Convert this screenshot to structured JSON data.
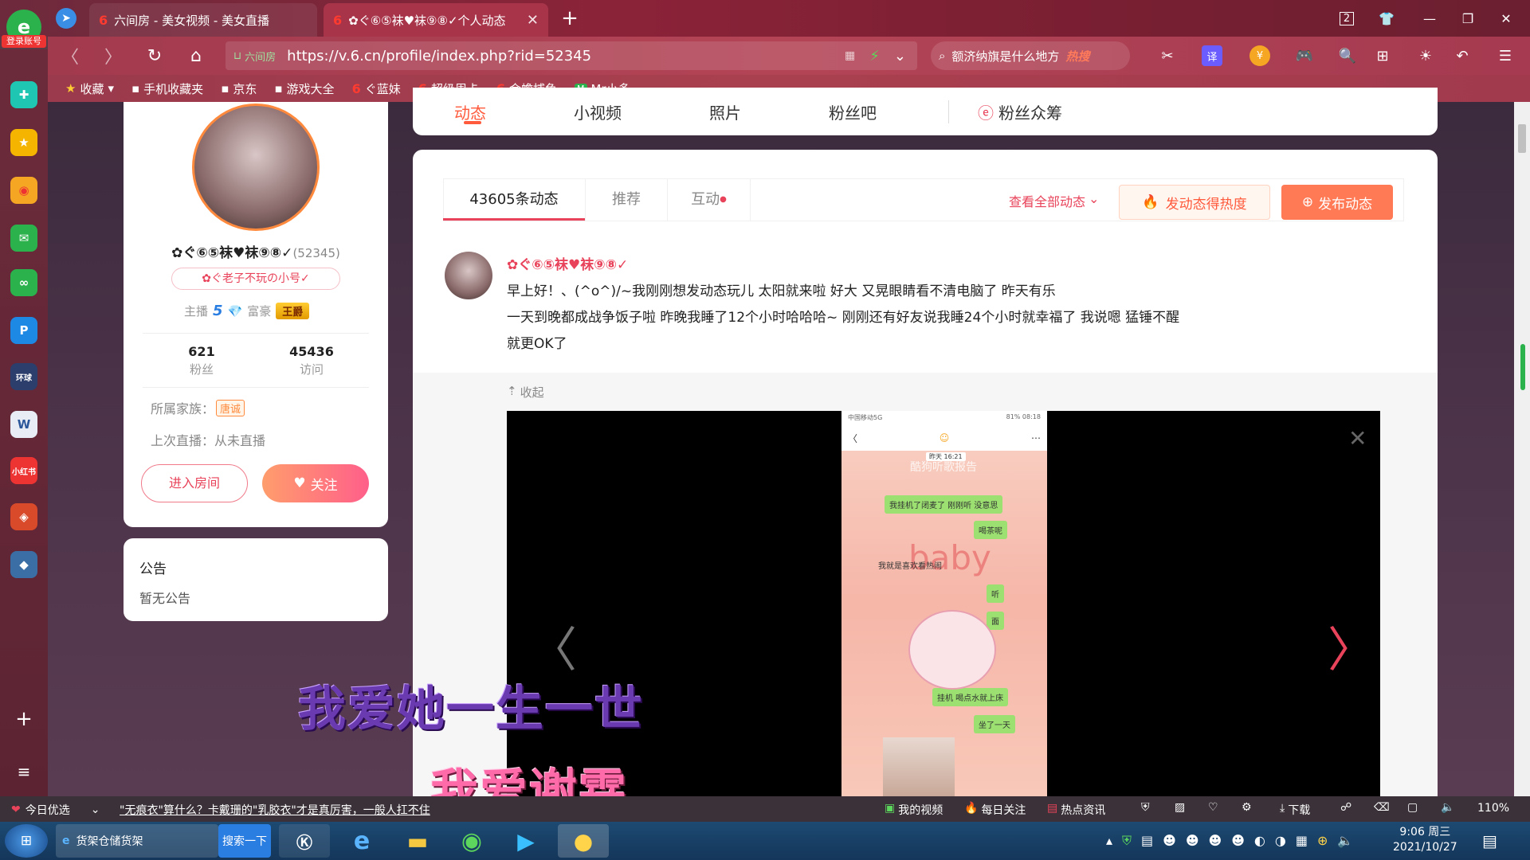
{
  "browser": {
    "login_badge": "登录账号",
    "tabs": [
      {
        "label": "六间房 - 美女视频 - 美女直播",
        "active": false
      },
      {
        "label": "✿ぐ⑥⑤袜♥袜⑨⑧✓个人动态",
        "active": true
      }
    ],
    "tab_count": "2",
    "url_prefix": "六间房",
    "url": "https://v.6.cn/profile/index.php?rid=52345",
    "search_text": "额济纳旗是什么地方",
    "search_hot": "热搜",
    "bookmarks": [
      "收藏",
      "手机收藏夹",
      "京东",
      "游戏大全",
      "ぐ蓝妹",
      "超级周卡",
      "金蟾捕鱼",
      "Mr小多"
    ]
  },
  "profile": {
    "nav_tabs": [
      "动态",
      "小视频",
      "照片",
      "粉丝吧",
      "粉丝众筹"
    ],
    "name": "✿ぐ⑥⑤袜♥袜⑨⑧✓",
    "rid": "(52345)",
    "alias": "✿ぐ老子不玩の小号✓",
    "anchor_label": "主播",
    "anchor_level": "5",
    "rich_label": "富豪",
    "rich_badge": "王爵",
    "fans_count": "621",
    "fans_label": "粉丝",
    "visits_count": "45436",
    "visits_label": "访问",
    "family_label": "所属家族：",
    "family_badge": "唐诚",
    "last_live": "上次直播：从未直播",
    "enter_room": "进入房间",
    "follow": "关注",
    "notice_title": "公告",
    "notice_text": "暂无公告"
  },
  "feed": {
    "tabs": [
      "43605条动态",
      "推荐",
      "互动"
    ],
    "view_all": "查看全部动态",
    "hot_btn": "发动态得热度",
    "post_btn": "发布动态",
    "post_author": "✿ぐ⑥⑤袜♥袜⑨⑧✓",
    "post_line1": "早上好！、(^o^)/~我刚刚想发动态玩儿 太阳就来啦 好大 又晃眼睛看不清电脑了 昨天有乐",
    "post_line2": "一天到晚都成战争饭子啦 昨晚我睡了12个小时哈哈哈~ 刚刚还有好友说我睡24个小时就幸福了 我说嗯 猛锤不醒",
    "post_line3": "就更OK了",
    "collapse": "收起",
    "chat_header": "中国移动5G",
    "chat_battery": "81% 08:18",
    "chat_time": "昨天 16:21",
    "chat_msgs": [
      "我挂机了闭麦了 刚刚听 没意思",
      "喝茶呢",
      "我就是喜欢看热闹",
      "听",
      "面",
      "挂机 喝点水就上床",
      "坐了一天"
    ],
    "chat_bg_title": "酷狗听歌报告",
    "chat_bg_baby": "baby",
    "overlay_text1": "我爱她一生一世",
    "overlay_text2": "我爱谢霖"
  },
  "statusbar": {
    "today": "今日优选",
    "headline": "\"无痕衣\"算什么？卡戴珊的\"乳胶衣\"才是真厉害，一般人扛不住",
    "my_video": "我的视频",
    "daily": "每日关注",
    "hot_news": "热点资讯",
    "download": "下载",
    "zoom": "110%"
  },
  "taskbar": {
    "app1": "货架仓储货架",
    "search": "搜索一下",
    "time": "9:06 周三",
    "date": "2021/10/27"
  },
  "colors": {
    "accent": "#ff5a3c",
    "pink": "#e8435a",
    "brand_orange": "#ff8a3d"
  }
}
